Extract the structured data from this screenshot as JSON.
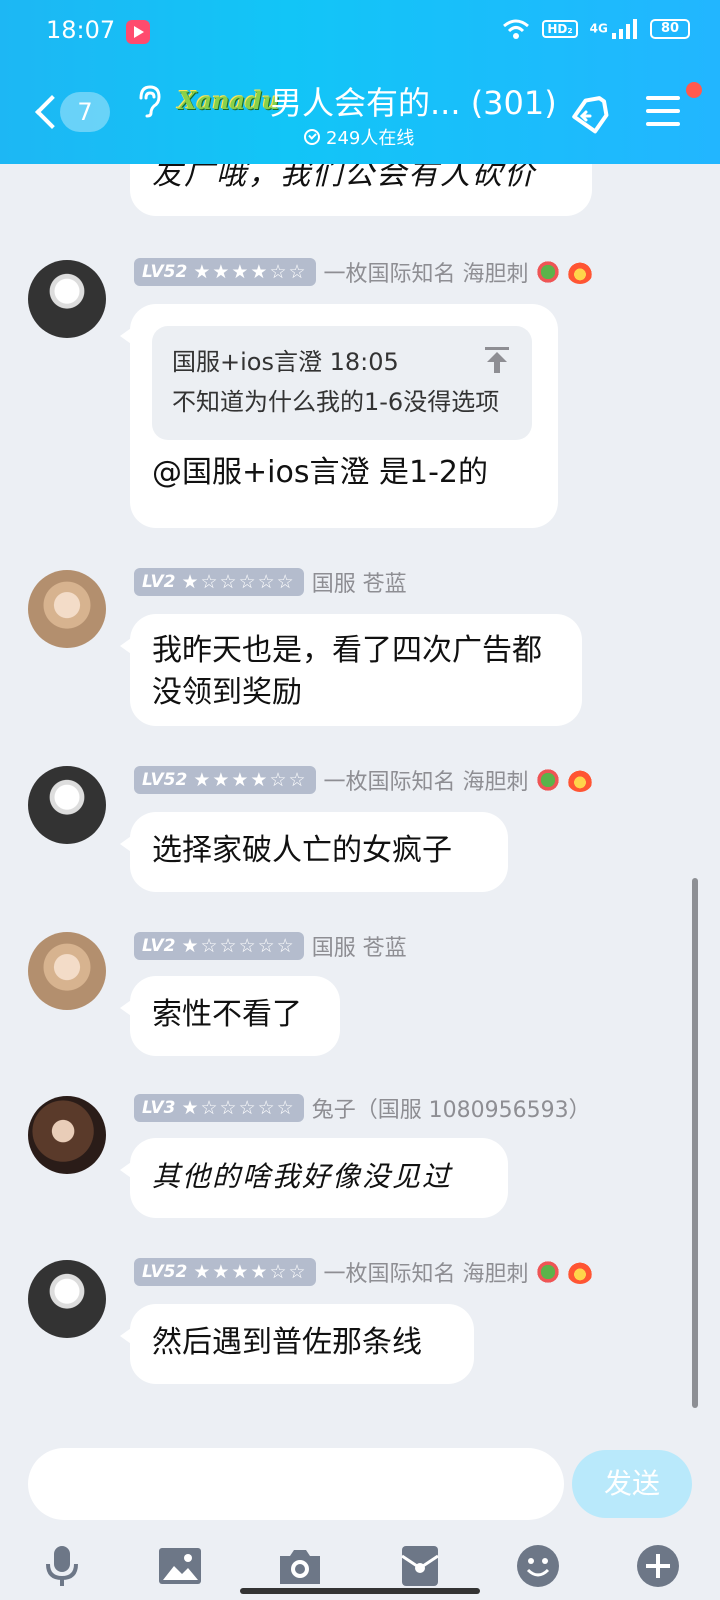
{
  "status_bar": {
    "time": "18:07",
    "network": "HD₂",
    "signal": "4G",
    "battery": "80"
  },
  "header": {
    "back_count": "7",
    "logo_text": "Xanadu",
    "title": "男人会有的... (301)",
    "online": "249人在线",
    "accent_color": "#1db7f4",
    "notification_dot_color": "#ff5a4e"
  },
  "messages": [
    {
      "text": "友广哦，我们公会有人砍价"
    },
    {
      "level": "LV52",
      "stars": "★★★★☆☆",
      "nickname": "一枚国际知名 海胆刺",
      "quote_header": "国服+ios言澄 18:05",
      "quote_text": "不知道为什么我的1-6没得选项",
      "text": "@国服+ios言澄 是1-2的"
    },
    {
      "level": "LV2",
      "stars": "★☆☆☆☆☆",
      "nickname": "国服 苍蓝",
      "text": "我昨天也是，看了四次广告都没领到奖励"
    },
    {
      "level": "LV52",
      "stars": "★★★★☆☆",
      "nickname": "一枚国际知名 海胆刺",
      "text": "选择家破人亡的女疯子"
    },
    {
      "level": "LV2",
      "stars": "★☆☆☆☆☆",
      "nickname": "国服 苍蓝",
      "text": "索性不看了"
    },
    {
      "level": "LV3",
      "stars": "★☆☆☆☆☆",
      "nickname": "兔子（国服 1080956593）",
      "text": "其他的啥我好像没见过"
    },
    {
      "level": "LV52",
      "stars": "★★★★☆☆",
      "nickname": "一枚国际知名 海胆刺",
      "text": "然后遇到普佐那条线"
    }
  ],
  "composer": {
    "placeholder": "",
    "send_label": "发送"
  },
  "toolbar_icons": [
    "microphone-icon",
    "image-icon",
    "camera-icon",
    "red-packet-icon",
    "emoji-icon",
    "plus-icon"
  ]
}
